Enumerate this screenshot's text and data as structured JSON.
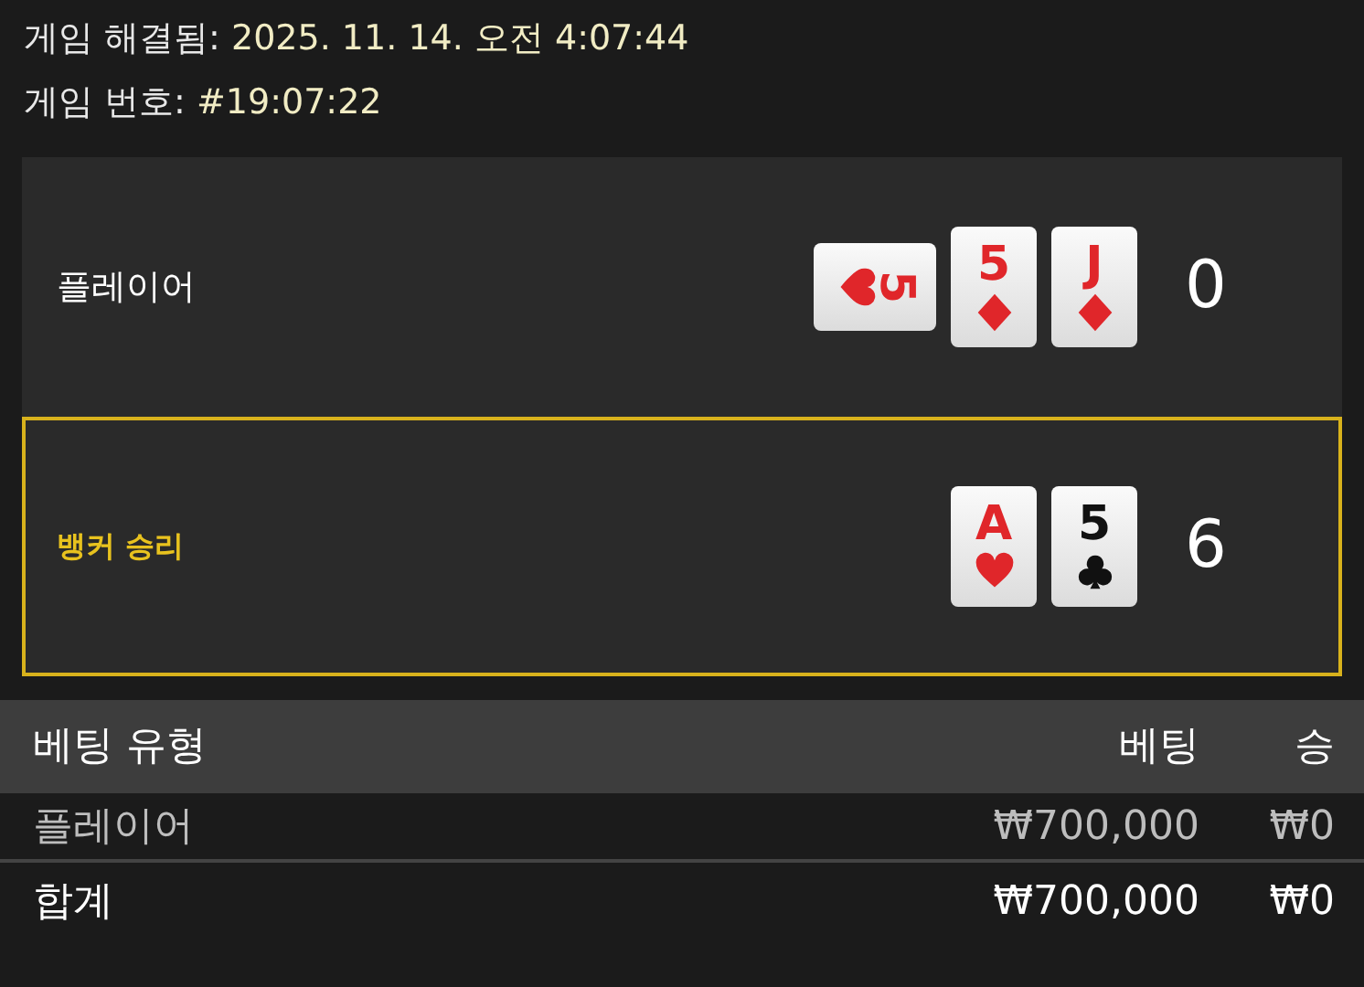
{
  "resolved": {
    "label": "게임 해결됨:",
    "value": "2025. 11. 14. 오전 4:07:44"
  },
  "game_number": {
    "label": "게임 번호:",
    "value": "#19:07:22"
  },
  "hands": [
    {
      "name": "플레이어",
      "winner": false,
      "score": "0",
      "cards": [
        {
          "rank": "5",
          "kind": "hearts",
          "rotated": true
        },
        {
          "rank": "5",
          "kind": "diamonds",
          "rotated": false
        },
        {
          "rank": "J",
          "kind": "diamonds",
          "rotated": false
        }
      ]
    },
    {
      "name": "뱅커 승리",
      "winner": true,
      "score": "6",
      "cards": [
        {
          "rank": "A",
          "kind": "hearts",
          "rotated": false
        },
        {
          "rank": "5",
          "kind": "clubs",
          "rotated": false
        }
      ]
    }
  ],
  "table": {
    "columns": [
      "베팅 유형",
      "베팅",
      "승"
    ],
    "rows": [
      {
        "kind": "bet",
        "cells": [
          "플레이어",
          "₩700,000",
          "₩0"
        ]
      },
      {
        "kind": "total",
        "cells": [
          "합계",
          "₩700,000",
          "₩0"
        ]
      }
    ]
  }
}
